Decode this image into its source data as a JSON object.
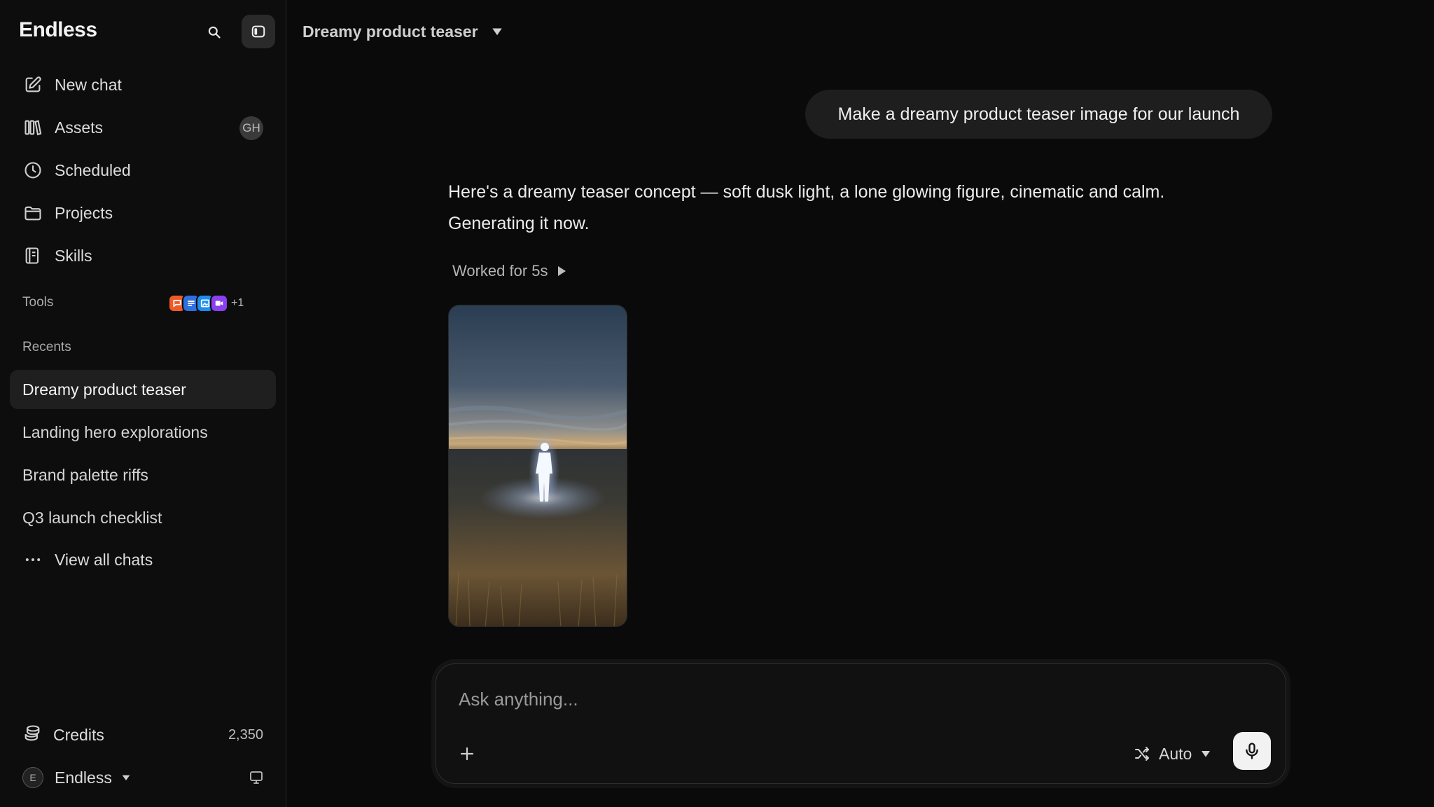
{
  "app": {
    "name": "Endless"
  },
  "sidebar": {
    "nav": [
      {
        "label": "New chat",
        "icon": "edit-icon"
      },
      {
        "label": "Assets",
        "icon": "library-icon",
        "badge": "GH"
      },
      {
        "label": "Scheduled",
        "icon": "clock-icon"
      },
      {
        "label": "Projects",
        "icon": "folder-icon"
      },
      {
        "label": "Skills",
        "icon": "book-icon"
      }
    ],
    "tools": {
      "label": "Tools",
      "count": "+1",
      "icons": [
        {
          "name": "chat-tool-icon",
          "color": "#f05a28"
        },
        {
          "name": "slack-tool-icon",
          "color": "#2f6fe0"
        },
        {
          "name": "image-tool-icon",
          "color": "#1e8cf0"
        },
        {
          "name": "video-tool-icon",
          "color": "#8a3ff0"
        }
      ]
    },
    "recents": {
      "label": "Recents",
      "items": [
        {
          "label": "Dreamy product teaser",
          "active": true
        },
        {
          "label": "Landing hero explorations"
        },
        {
          "label": "Brand palette riffs"
        },
        {
          "label": "Q3 launch checklist"
        }
      ],
      "view_all": "View all chats"
    },
    "credits": {
      "label": "Credits",
      "value": "2,350"
    },
    "account": {
      "initial": "E",
      "name": "Endless"
    }
  },
  "main": {
    "chat_title": "Dreamy product teaser",
    "messages": {
      "user": "Make a dreamy product teaser image for our launch",
      "assistant": "Here's a dreamy teaser concept — soft dusk light, a lone glowing figure, cinematic and calm. Generating it now.",
      "worked_label": "Worked for 5s"
    },
    "composer": {
      "placeholder": "Ask anything...",
      "mode_label": "Auto"
    }
  }
}
